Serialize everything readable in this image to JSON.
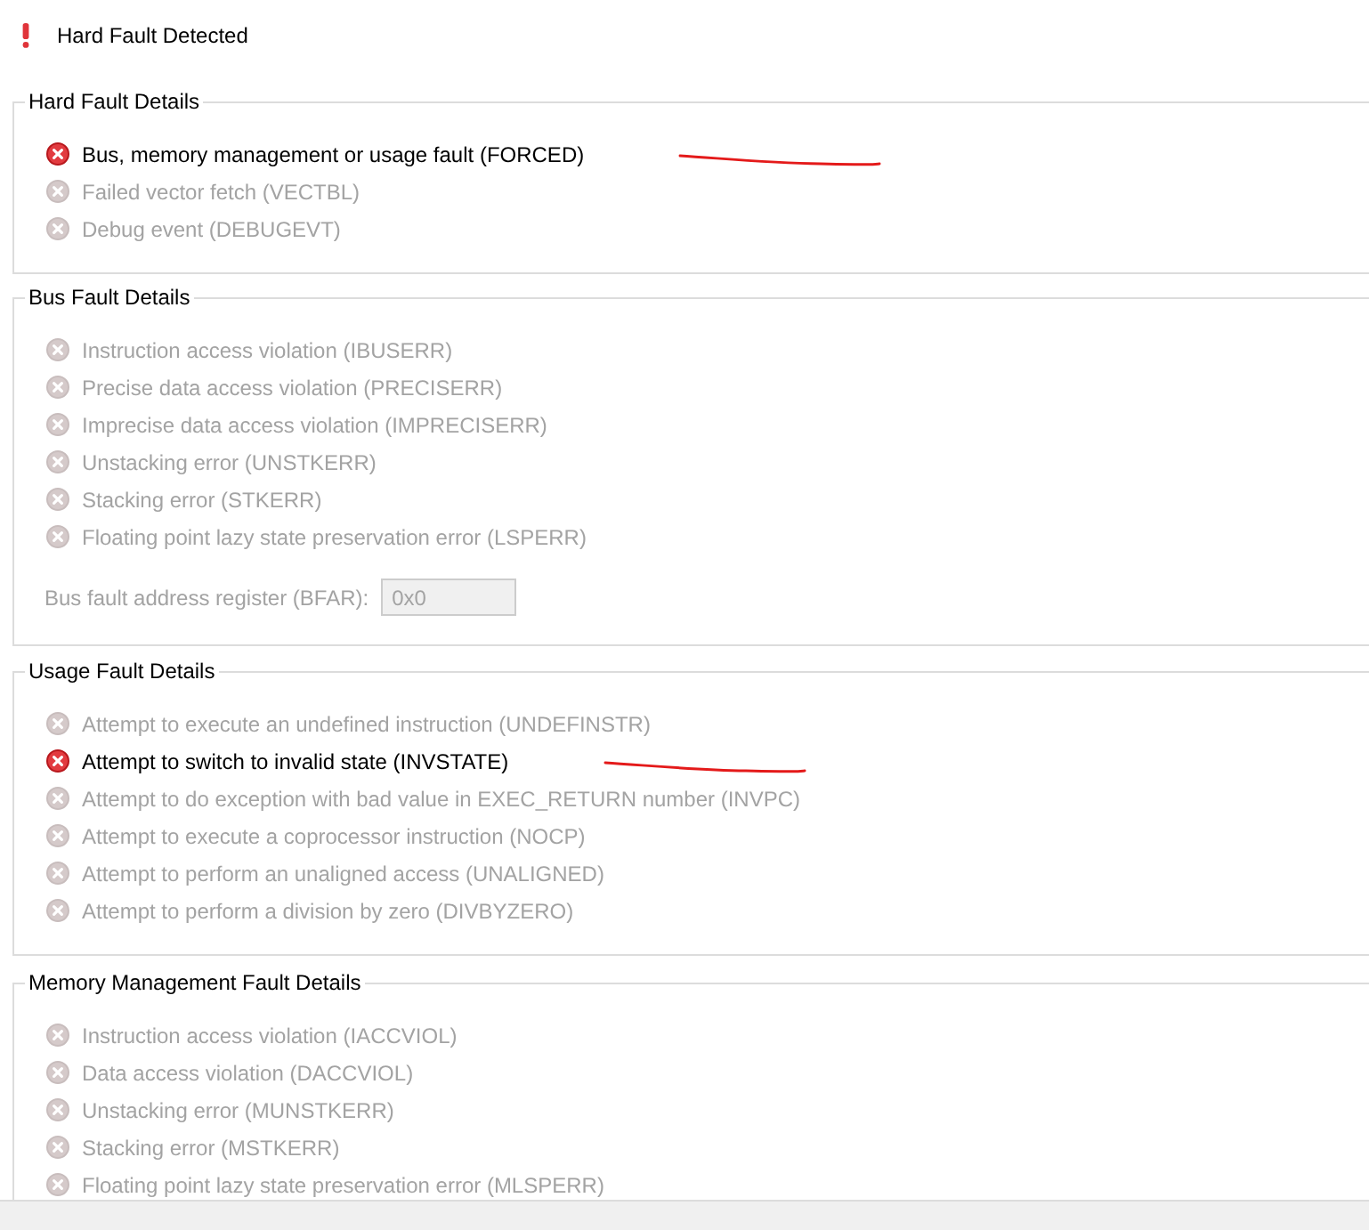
{
  "header": {
    "title": "Hard Fault Detected"
  },
  "groups": [
    {
      "title": "Hard Fault Details",
      "items": [
        {
          "label": "Bus, memory management or usage fault (FORCED)",
          "active": true,
          "annotated": true
        },
        {
          "label": "Failed vector fetch (VECTBL)",
          "active": false,
          "annotated": false
        },
        {
          "label": "Debug event (DEBUGEVT)",
          "active": false,
          "annotated": false
        }
      ]
    },
    {
      "title": "Bus Fault Details",
      "items": [
        {
          "label": "Instruction access violation (IBUSERR)",
          "active": false,
          "annotated": false
        },
        {
          "label": "Precise data access violation (PRECISERR)",
          "active": false,
          "annotated": false
        },
        {
          "label": "Imprecise data access violation (IMPRECISERR)",
          "active": false,
          "annotated": false
        },
        {
          "label": "Unstacking error (UNSTKERR)",
          "active": false,
          "annotated": false
        },
        {
          "label": "Stacking error (STKERR)",
          "active": false,
          "annotated": false
        },
        {
          "label": "Floating point lazy state preservation error (LSPERR)",
          "active": false,
          "annotated": false
        }
      ],
      "register": {
        "label": "Bus fault address register (BFAR):",
        "value": "0x0",
        "disabled": true
      }
    },
    {
      "title": "Usage Fault Details",
      "items": [
        {
          "label": "Attempt to execute an undefined instruction (UNDEFINSTR)",
          "active": false,
          "annotated": false
        },
        {
          "label": "Attempt to switch to invalid state (INVSTATE)",
          "active": true,
          "annotated": true
        },
        {
          "label": "Attempt to do exception with bad value in EXEC_RETURN number (INVPC)",
          "active": false,
          "annotated": false
        },
        {
          "label": "Attempt to execute a coprocessor instruction (NOCP)",
          "active": false,
          "annotated": false
        },
        {
          "label": "Attempt to perform an unaligned access (UNALIGNED)",
          "active": false,
          "annotated": false
        },
        {
          "label": "Attempt to perform a division by zero (DIVBYZERO)",
          "active": false,
          "annotated": false
        }
      ]
    },
    {
      "title": "Memory Management Fault Details",
      "items": [
        {
          "label": "Instruction access violation (IACCVIOL)",
          "active": false,
          "annotated": false
        },
        {
          "label": "Data access violation (DACCVIOL)",
          "active": false,
          "annotated": false
        },
        {
          "label": "Unstacking error (MUNSTKERR)",
          "active": false,
          "annotated": false
        },
        {
          "label": "Stacking error (MSTKERR)",
          "active": false,
          "annotated": false
        },
        {
          "label": "Floating point lazy state preservation error (MLSPERR)",
          "active": false,
          "annotated": false
        }
      ]
    }
  ]
}
